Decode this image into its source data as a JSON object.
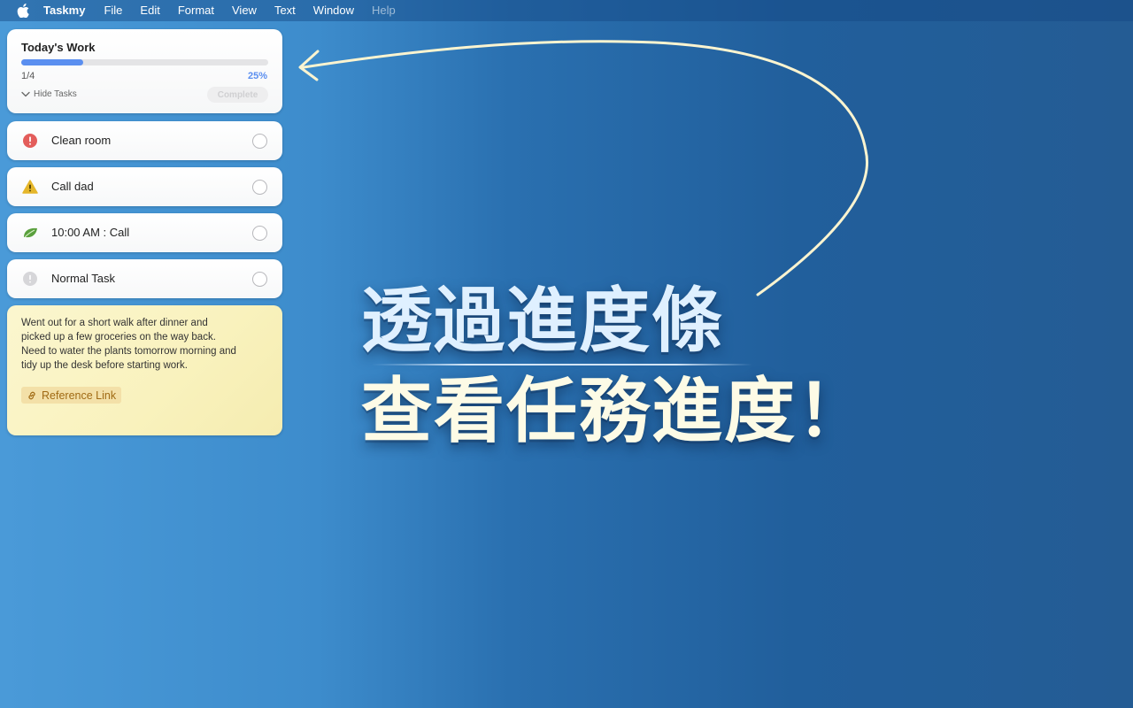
{
  "menubar": {
    "apple_icon": "apple-logo-icon",
    "app_name": "Taskmy",
    "items": [
      "File",
      "Edit",
      "Format",
      "View",
      "Text",
      "Window",
      "Help"
    ]
  },
  "progress_card": {
    "title": "Today's Work",
    "completed": 1,
    "total": 4,
    "count_text": "1/4",
    "percent": 25,
    "percent_text": "25%",
    "hide_tasks_label": "Hide Tasks",
    "complete_label": "Complete"
  },
  "tasks": [
    {
      "label": "Clean room",
      "icon": "exclamation-circle-icon",
      "color": "#e35d5b",
      "done": false
    },
    {
      "label": "Call dad",
      "icon": "warning-triangle-icon",
      "color": "#e5b62a",
      "done": false
    },
    {
      "label": "10:00 AM : Call",
      "icon": "leaf-icon",
      "color": "#5aa03d",
      "done": false
    },
    {
      "label": "Normal Task",
      "icon": "info-circle-icon",
      "color": "#cfcfd2",
      "done": false
    }
  ],
  "note": {
    "lines": [
      "Went out for a short walk after dinner and",
      "picked up a few groceries on the way back.",
      "Need to water the plants tomorrow morning and",
      "tidy up the desk before starting work."
    ],
    "link_label": "Reference Link"
  },
  "headline": {
    "line1": "透過進度條",
    "line2": "查看任務進度！"
  },
  "colors": {
    "accent": "#5b8ff0",
    "link": "#a06a14",
    "note_bg": "#f9f2bd"
  }
}
